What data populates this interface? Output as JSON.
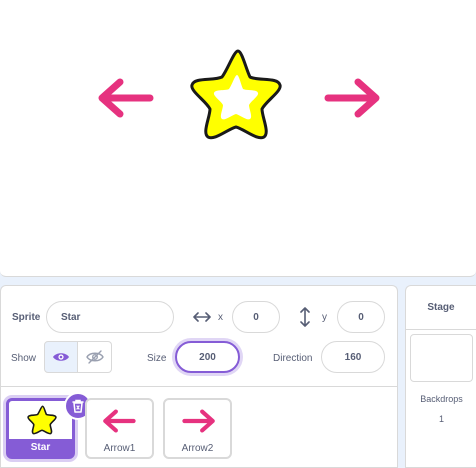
{
  "stage": {
    "sprites": [
      {
        "name": "Star",
        "icon": "star-icon"
      },
      {
        "name": "Arrow1",
        "icon": "arrow-left-icon"
      },
      {
        "name": "Arrow2",
        "icon": "arrow-right-icon"
      }
    ]
  },
  "sprite_info": {
    "sprite_label": "Sprite",
    "sprite_name": "Star",
    "x_label": "x",
    "x_value": "0",
    "y_label": "y",
    "y_value": "0",
    "show_label": "Show",
    "size_label": "Size",
    "size_value": "200",
    "direction_label": "Direction",
    "direction_value": "160"
  },
  "sprite_list": {
    "items": [
      {
        "name": "Star",
        "selected": true
      },
      {
        "name": "Arrow1",
        "selected": false
      },
      {
        "name": "Arrow2",
        "selected": false
      }
    ]
  },
  "stage_panel": {
    "title": "Stage",
    "backdrops_label": "Backdrops",
    "backdrops_count": "1"
  },
  "colors": {
    "accent": "#855cd6",
    "arrow": "#e6327f",
    "star_fill": "#ffff00"
  }
}
